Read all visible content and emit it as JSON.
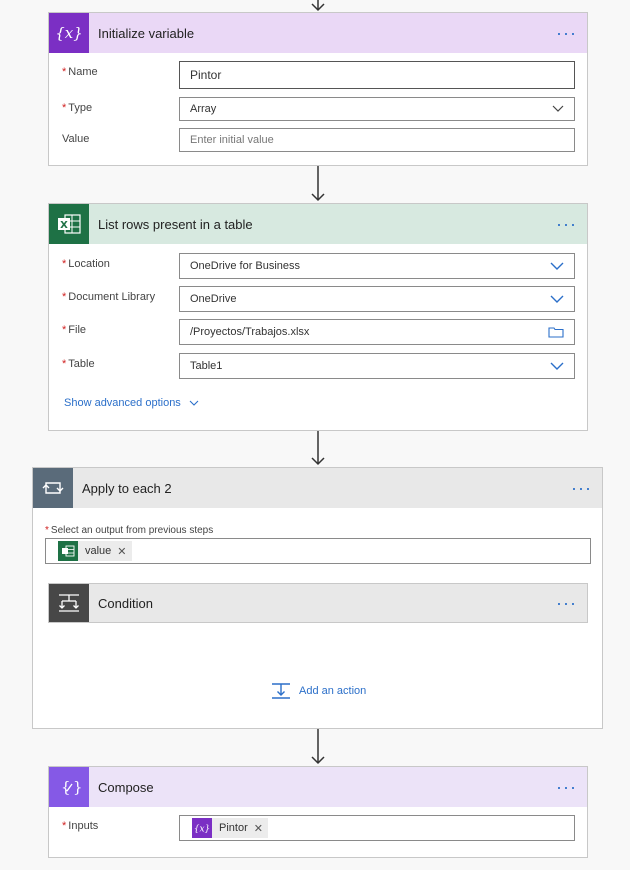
{
  "init_var": {
    "title": "Initialize variable",
    "icon": "variable-icon",
    "name_label": "Name",
    "name_value": "Pintor",
    "type_label": "Type",
    "type_value": "Array",
    "value_label": "Value",
    "value_placeholder": "Enter initial value",
    "color": "#ead8f6",
    "icon_color": "#7b2fc4"
  },
  "list_rows": {
    "title": "List rows present in a table",
    "icon": "excel-icon",
    "location_label": "Location",
    "location_value": "OneDrive for Business",
    "library_label": "Document Library",
    "library_value": "OneDrive",
    "file_label": "File",
    "file_value": "/Proyectos/Trabajos.xlsx",
    "table_label": "Table",
    "table_value": "Table1",
    "advanced_link": "Show advanced options",
    "color": "#d7e9e0",
    "icon_color": "#1e7145"
  },
  "apply_each": {
    "title": "Apply to each 2",
    "icon": "loop-icon",
    "select_label": "Select an output from previous steps",
    "token_label": "value",
    "color": "#e8e8e8",
    "icon_color": "#5a6b7a"
  },
  "condition": {
    "title": "Condition",
    "icon": "condition-icon",
    "icon_color": "#474747"
  },
  "add_action": {
    "label": "Add an action"
  },
  "compose": {
    "title": "Compose",
    "icon": "compose-icon",
    "inputs_label": "Inputs",
    "token_label": "Pintor",
    "color": "#ece3f8",
    "icon_color": "#8559e6"
  }
}
